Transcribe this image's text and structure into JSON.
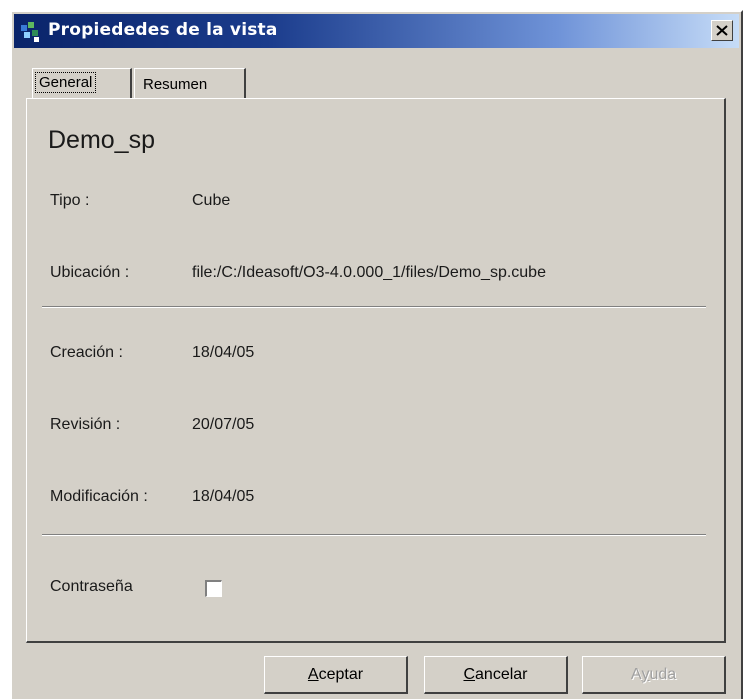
{
  "window": {
    "title": "Propiededes de la vista",
    "close_symbol": "✕"
  },
  "tabs": [
    {
      "label": "General",
      "active": true
    },
    {
      "label": "Resumen",
      "active": false
    }
  ],
  "view": {
    "name": "Demo_sp"
  },
  "fields": {
    "tipo": {
      "label": "Tipo :",
      "value": "Cube"
    },
    "ubicacion": {
      "label": "Ubicación :",
      "value": "file:/C:/Ideasoft/O3-4.0.000_1/files/Demo_sp.cube"
    },
    "creacion": {
      "label": "Creación :",
      "value": "18/04/05"
    },
    "revision": {
      "label": "Revisión :",
      "value": "20/07/05"
    },
    "modificacion": {
      "label": "Modificación :",
      "value": "18/04/05"
    },
    "contrasena": {
      "label": "Contraseña",
      "checked": false
    }
  },
  "buttons": {
    "aceptar": {
      "mnemonic": "A",
      "rest": "ceptar"
    },
    "cancelar": {
      "mnemonic": "C",
      "rest": "ancelar"
    },
    "ayuda": {
      "pre": "A",
      "mnemonic": "y",
      "rest": "uda",
      "enabled": false
    }
  },
  "colors": {
    "titlebar_start": "#0a246a",
    "titlebar_end": "#c6dcf7",
    "face": "#d4d0c8"
  }
}
